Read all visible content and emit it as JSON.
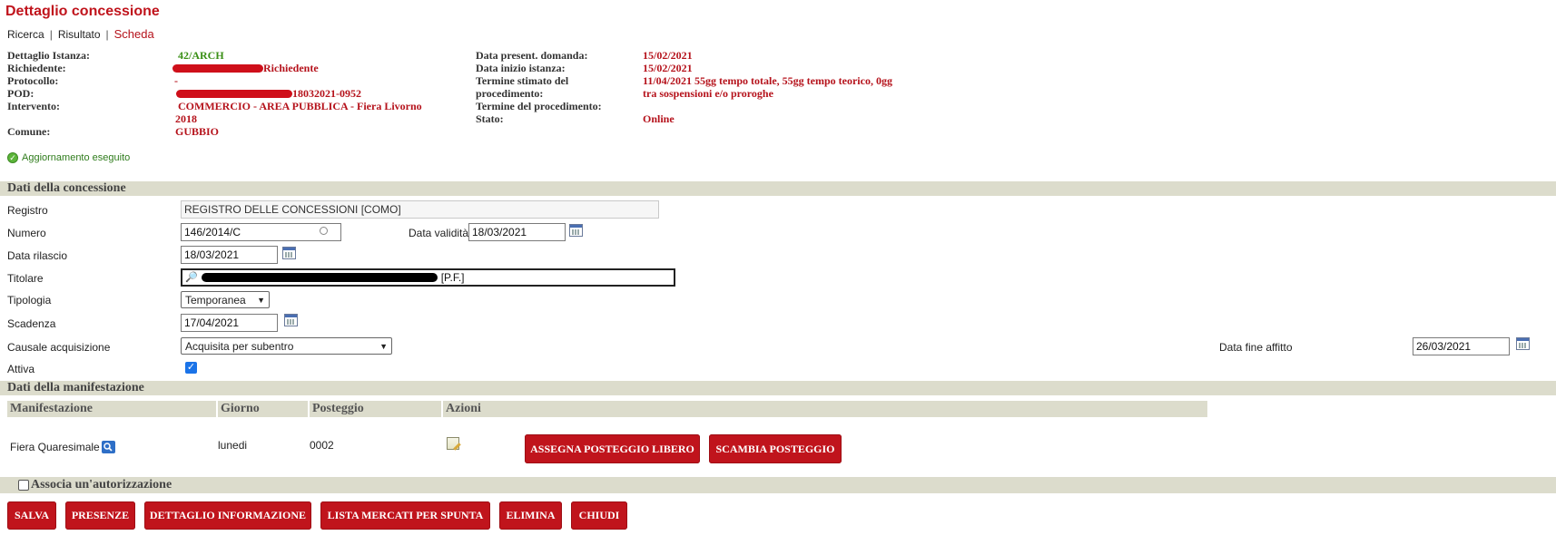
{
  "page": {
    "title": "Dettaglio concessione"
  },
  "breadcrumbs": [
    {
      "label": "Ricerca"
    },
    {
      "label": "Risultato"
    },
    {
      "label": "Scheda"
    }
  ],
  "sep": "|",
  "instance": {
    "left": [
      {
        "label": "Dettaglio Istanza:",
        "value": "42/ARCH"
      },
      {
        "label": "Richiedente:",
        "value": "Richiedente"
      },
      {
        "label": "Protocollo:",
        "value": "-"
      },
      {
        "label": "POD:",
        "value": "18032021-0952"
      },
      {
        "label": "Intervento:",
        "value": "COMMERCIO - AREA PUBBLICA - Fiera Livorno 2018"
      },
      {
        "label": "Comune:",
        "value": "GUBBIO"
      }
    ],
    "right": [
      {
        "label": "Data present. domanda:",
        "value": "15/02/2021"
      },
      {
        "label": "Data inizio istanza:",
        "value": "15/02/2021"
      },
      {
        "label": "Termine stimato del procedimento:",
        "value": "11/04/2021  55gg tempo totale, 55gg tempo teorico, 0gg tra sospensioni e/o proroghe"
      },
      {
        "label": "Termine del procedimento:",
        "value": ""
      },
      {
        "label": "Stato:",
        "value": "Online"
      }
    ]
  },
  "status_message": "Aggiornamento eseguito",
  "concessione": {
    "section_title": "Dati della concessione",
    "registro_label": "Registro",
    "registro_value": "REGISTRO DELLE CONCESSIONI [COMO]",
    "numero_label": "Numero",
    "numero_value": "146/2014/C",
    "data_validita_label": "Data validità",
    "data_validita_value": "18/03/2021",
    "data_rilascio_label": "Data rilascio",
    "data_rilascio_value": "18/03/2021",
    "titolare_label": "Titolare",
    "titolare_suffix": "[P.F.]",
    "tipologia_label": "Tipologia",
    "tipologia_value": "Temporanea",
    "scadenza_label": "Scadenza",
    "scadenza_value": "17/04/2021",
    "causale_label": "Causale acquisizione",
    "causale_value": "Acquisita per subentro",
    "data_fine_affitto_label": "Data fine affitto",
    "data_fine_affitto_value": "26/03/2021",
    "attiva_label": "Attiva",
    "attiva_checked": true
  },
  "manifestazione": {
    "section_title": "Dati della manifestazione",
    "columns": [
      "Manifestazione",
      "Giorno",
      "Posteggio",
      "Azioni"
    ],
    "row": {
      "manifestazione": "Fiera Quaresimale",
      "giorno": "lunedi",
      "posteggio": "0002"
    },
    "assegna_label": "ASSEGNA POSTEGGIO LIBERO",
    "scambia_label": "SCAMBIA POSTEGGIO"
  },
  "associa_label": "Associa un'autorizzazione",
  "actions": {
    "salva": "SALVA",
    "presenze": "PRESENZE",
    "dettaglio": "DETTAGLIO INFORMAZIONE",
    "lista": "LISTA MERCATI PER SPUNTA",
    "elimina": "ELIMINA",
    "chiudi": "CHIUDI"
  },
  "colors": {
    "brand_red": "#c0141c",
    "section_bg": "#dcdccc",
    "success_green": "#2f7c1c"
  }
}
